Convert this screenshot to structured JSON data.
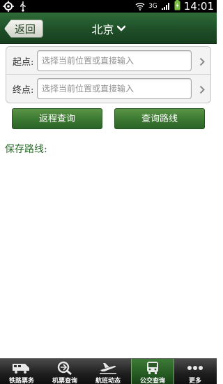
{
  "status_bar": {
    "network": "3G",
    "time": "14:01",
    "icons": [
      "gps-icon",
      "usb-icon",
      "wifi-icon",
      "signal-icon",
      "battery-icon"
    ]
  },
  "header": {
    "back_label": "返回",
    "city": "北京"
  },
  "form": {
    "start_label": "起点:",
    "start_placeholder": "选择当前位置或直接输入",
    "end_label": "终点:",
    "end_placeholder": "选择当前位置或直接输入"
  },
  "actions": {
    "return_label": "返程查询",
    "route_label": "查询路线"
  },
  "saved": {
    "title": "保存路线:"
  },
  "tabs": [
    {
      "label": "铁路票务",
      "icon": "train-icon",
      "active": false
    },
    {
      "label": "机票查询",
      "icon": "ticket-search-icon",
      "active": false
    },
    {
      "label": "航班动态",
      "icon": "airplane-icon",
      "active": false
    },
    {
      "label": "公交查询",
      "icon": "bus-icon",
      "active": true
    },
    {
      "label": "更多",
      "icon": "more-icon",
      "active": false
    }
  ],
  "colors": {
    "header_green": "#1f4f28",
    "button_green": "#3d7a33",
    "saved_title": "#2a6a2a"
  }
}
